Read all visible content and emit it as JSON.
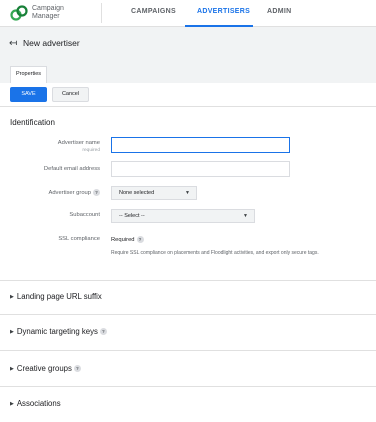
{
  "app": {
    "name_line1": "Campaign",
    "name_line2": "Manager"
  },
  "nav": {
    "tabs": [
      {
        "label": "CAMPAIGNS"
      },
      {
        "label": "ADVERTISERS"
      },
      {
        "label": "ADMIN"
      }
    ]
  },
  "page": {
    "title": "New advertiser",
    "tab": "Properties"
  },
  "actions": {
    "save": "SAVE",
    "cancel": "Cancel"
  },
  "identification": {
    "title": "Identification",
    "advertiser_name": {
      "label": "Advertiser name",
      "sub": "required",
      "value": ""
    },
    "default_email": {
      "label": "Default email address",
      "value": ""
    },
    "advertiser_group": {
      "label": "Advertiser group",
      "help": "?",
      "value": "None selected"
    },
    "subaccount": {
      "label": "Subaccount",
      "value": "-- Select --"
    },
    "ssl": {
      "label": "SSL compliance",
      "value": "Required",
      "help": "?",
      "desc": "Require SSL compliance on placements and Floodlight activities, and export only secure tags."
    }
  },
  "sections": [
    {
      "label": "Landing page URL suffix",
      "help": ""
    },
    {
      "label": "Dynamic targeting keys",
      "help": "?"
    },
    {
      "label": "Creative groups",
      "help": "?"
    },
    {
      "label": "Associations",
      "help": ""
    }
  ],
  "colors": {
    "accent": "#1a73e8",
    "background_gray": "#f1f3f4"
  }
}
